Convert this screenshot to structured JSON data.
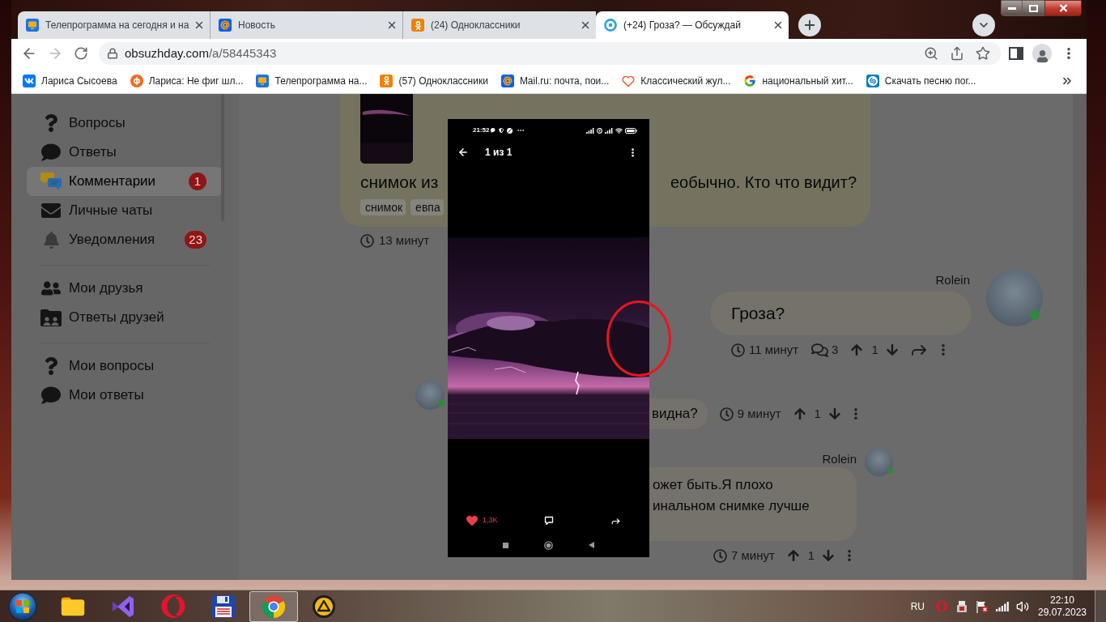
{
  "tabs": [
    {
      "title": "Телепрограмма на сегодня и на",
      "selected": false
    },
    {
      "title": "Новость",
      "selected": false
    },
    {
      "title": "(24) Одноклассники",
      "selected": false
    },
    {
      "title": "(+24) Гроза? — Обсуждай",
      "selected": true
    }
  ],
  "address_bar": {
    "host": "obsuzhday.com",
    "path": "/a/58445343"
  },
  "bookmarks": [
    {
      "label": "Лариса Сысоева"
    },
    {
      "label": "Лариса: Не фиг шл..."
    },
    {
      "label": "Телепрограмма на..."
    },
    {
      "label": "(57) Одноклассники"
    },
    {
      "label": "Mail.ru: почта, пои..."
    },
    {
      "label": "Классический жул..."
    },
    {
      "label": "национальный хит..."
    },
    {
      "label": "Скачать песню пог..."
    }
  ],
  "sidebar": {
    "sections": [
      {
        "items": [
          {
            "label": "Вопросы",
            "selected": false
          },
          {
            "label": "Ответы",
            "selected": false
          },
          {
            "label": "Комментарии",
            "selected": true,
            "badge": "1"
          },
          {
            "label": "Личные чаты",
            "selected": false
          },
          {
            "label": "Уведомления",
            "selected": false,
            "badge": "23"
          }
        ]
      },
      {
        "items": [
          {
            "label": "Мои друзья",
            "selected": false
          },
          {
            "label": "Ответы друзей",
            "selected": false
          }
        ]
      },
      {
        "items": [
          {
            "label": "Мои вопросы",
            "selected": false
          },
          {
            "label": "Мои ответы",
            "selected": false
          }
        ]
      }
    ]
  },
  "post": {
    "text_start": "снимок из",
    "text_end": "еобычно. Кто что видит?",
    "tags": [
      "снимок",
      "евпа"
    ],
    "time": "13 минут"
  },
  "comments": [
    {
      "kind": "comment",
      "author": "Rolein",
      "online": true,
      "text": "Гроза?",
      "time": "11 минут",
      "replies": "3",
      "votes": "1"
    },
    {
      "kind": "incoming",
      "online": true,
      "text": "видна?",
      "time": "9 минут",
      "votes": "1"
    },
    {
      "kind": "outgoing",
      "author": "Rolein",
      "online": true,
      "lines": [
        "ожет быть.Я плохо",
        "инальном снимке лучше"
      ],
      "time": "7 минут",
      "votes": "1"
    }
  ],
  "viewer": {
    "status_time": "21:52",
    "counter": "1 из 1",
    "liked": true,
    "likes": "1,3K"
  },
  "taskbar": {
    "apps": [
      {
        "selected": false
      },
      {
        "selected": false
      },
      {
        "selected": false
      },
      {
        "selected": false
      },
      {
        "selected": true
      },
      {
        "selected": false
      }
    ],
    "language": "RU",
    "time": "22:10",
    "date": "29.07.2023"
  }
}
